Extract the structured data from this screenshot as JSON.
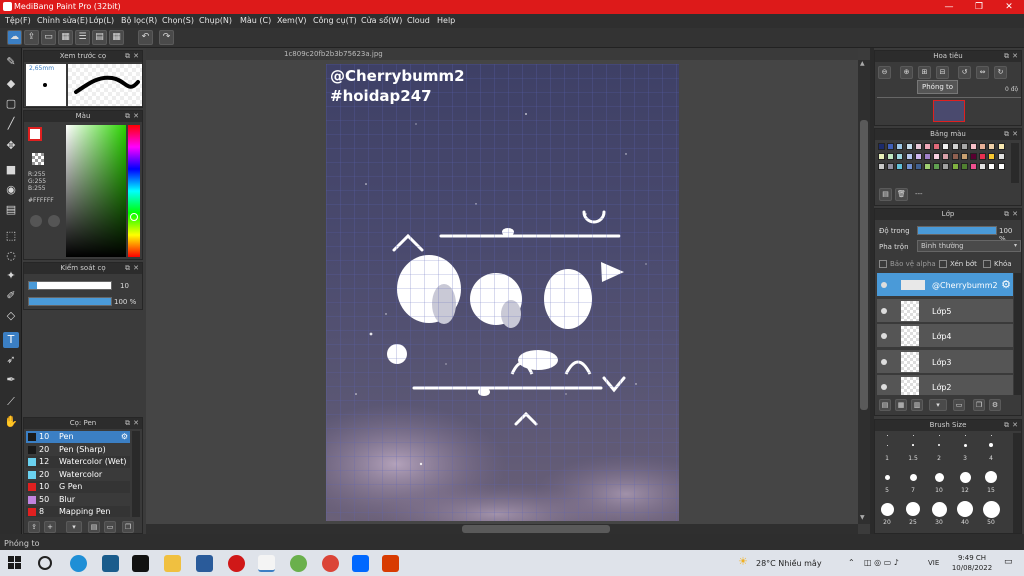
{
  "window": {
    "title": "MediBang Paint Pro (32bit)",
    "controls": [
      "—",
      "❐",
      "✕"
    ]
  },
  "menu": [
    "Tệp(F)",
    "Chỉnh sửa(E)",
    "Lớp(L)",
    "Bộ lọc(R)",
    "Chọn(S)",
    "Chụp(N)",
    "Màu (C)",
    "Xem(V)",
    "Công cụ(T)",
    "Cửa sổ(W)",
    "Cloud",
    "Help"
  ],
  "document": {
    "tab": "1c809c20fb2b3b75623a.jpg",
    "watermark_line1": "@Cherrybumm2",
    "watermark_line2": "#hoidap247"
  },
  "brush_preview": {
    "title": "Xem trước cọ",
    "size": "2,65mm"
  },
  "color_panel": {
    "title": "Màu",
    "r": "R:255",
    "g": "G:255",
    "b": "B:255",
    "hex": "#FFFFFF"
  },
  "brush_control": {
    "title": "Kiểm soát cọ",
    "size_value": "10",
    "opacity_value": "100 %",
    "size_fraction": 0.1,
    "opacity_fraction": 1.0
  },
  "brush_list": {
    "title": "Cọ: Pen",
    "items": [
      {
        "size": "10",
        "name": "Pen",
        "color": "#1a1a1a",
        "selected": true
      },
      {
        "size": "20",
        "name": "Pen (Sharp)",
        "color": "#1a1a1a"
      },
      {
        "size": "12",
        "name": "Watercolor (Wet)",
        "color": "#6ad1ef"
      },
      {
        "size": "20",
        "name": "Watercolor",
        "color": "#6ad1ef"
      },
      {
        "size": "10",
        "name": "G Pen",
        "color": "#e02020"
      },
      {
        "size": "50",
        "name": "Blur",
        "color": "#c084e0"
      },
      {
        "size": "8",
        "name": "Mapping Pen",
        "color": "#e02020"
      }
    ]
  },
  "navigator": {
    "title": "Hoa tiêu",
    "tooltip": "Phóng to",
    "rotation": "0 độ"
  },
  "palette": {
    "title": "Bảng màu",
    "dash": "---",
    "colors": [
      "#1c2b6b",
      "#3f5fb8",
      "#9ec8e8",
      "#c8e0f0",
      "#e8c8d8",
      "#f0a8b8",
      "#e06878",
      "#f0f0f0",
      "#d0d0d0",
      "#a8a8a8",
      "#f8c0c8",
      "#e8b098",
      "#f0d0a8",
      "#f8e8b0",
      "#e8f0b8",
      "#c0e8c0",
      "#a0d8e0",
      "#b8c8f0",
      "#d0b8f0",
      "#a080c8",
      "#f8d0e0",
      "#d8a0a8",
      "#906050",
      "#c8a070",
      "#580030",
      "#e83050",
      "#f8c830",
      "#e0e0e0",
      "#c8c8c8",
      "#9090a0",
      "#60c0d8",
      "#7090d0",
      "#406090",
      "#a0d070",
      "#60a050",
      "#a0a0a0",
      "#80b040",
      "#508030",
      "#f05090",
      "#e0e0e0",
      "#ffffff",
      "#ffffff"
    ]
  },
  "layers": {
    "title": "Lớp",
    "opacity_label": "Độ trong",
    "opacity_value": "100 %",
    "blend_label": "Pha trộn",
    "blend_value": "Bình thường",
    "protect_alpha": "Bảo vệ alpha",
    "clip": "Xén bớt",
    "lock": "Khóa",
    "items": [
      {
        "name": "@Cherrybumm2",
        "selected": true
      },
      {
        "name": "Lớp5"
      },
      {
        "name": "Lớp4"
      },
      {
        "name": "Lớp3"
      },
      {
        "name": "Lớp2"
      }
    ]
  },
  "brush_size": {
    "title": "Brush Size",
    "labels": [
      "1",
      "1.5",
      "2",
      "3",
      "4",
      "5",
      "7",
      "10",
      "12",
      "15",
      "20",
      "25",
      "30",
      "40",
      "50"
    ]
  },
  "status": {
    "text": "Phóng to"
  },
  "taskbar": {
    "weather": "28°C  Nhiều mây",
    "lang": "VIE",
    "time": "9:49 CH",
    "date": "10/08/2022"
  }
}
